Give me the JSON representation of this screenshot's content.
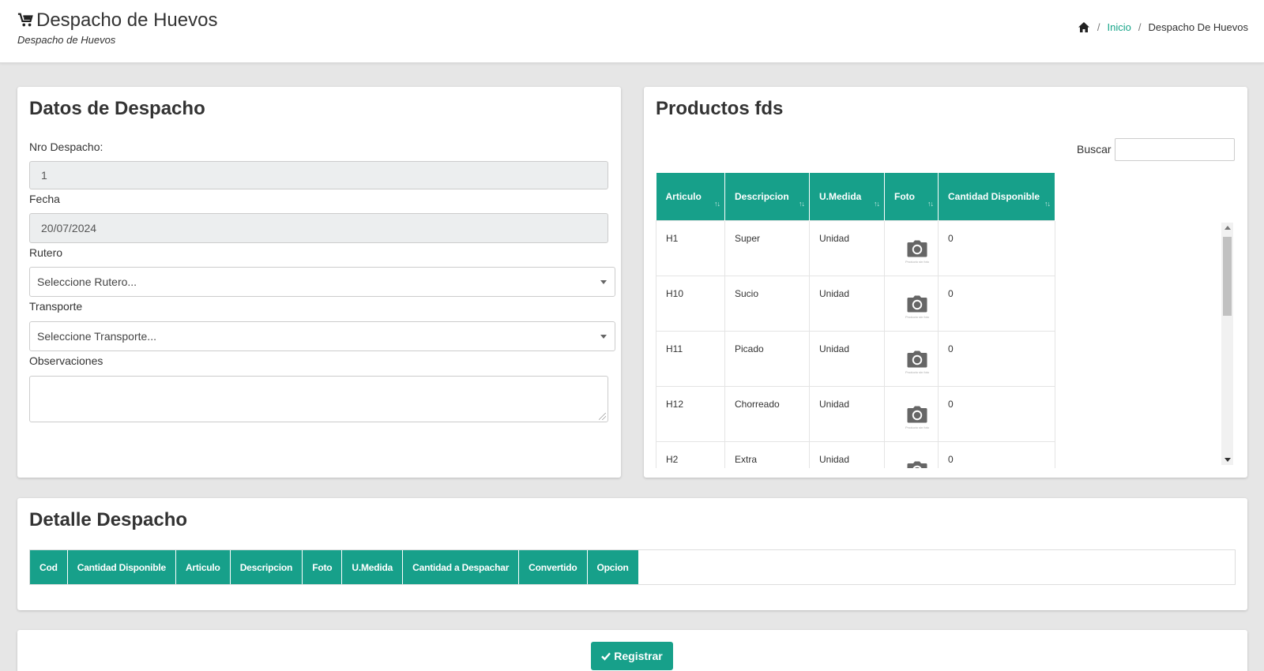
{
  "header": {
    "title": "Despacho de Huevos",
    "subtitle": "Despacho de Huevos",
    "breadcrumb": {
      "home": "Inicio",
      "sep": "/",
      "current": "Despacho De Huevos"
    }
  },
  "datos": {
    "title": "Datos de Despacho",
    "nro_label": "Nro Despacho:",
    "nro_value": "1",
    "fecha_label": "Fecha",
    "fecha_value": "20/07/2024",
    "rutero_label": "Rutero",
    "rutero_value": "Seleccione Rutero...",
    "transporte_label": "Transporte",
    "transporte_value": "Seleccione Transporte...",
    "obs_label": "Observaciones",
    "obs_value": ""
  },
  "productos": {
    "title": "Productos fds",
    "search_label": "Buscar",
    "columns": [
      "Articulo",
      "Descripcion",
      "U.Medida",
      "Foto",
      "Cantidad Disponible"
    ],
    "sort_icon": "↑↓",
    "photo_caption": "Producto sin foto",
    "rows": [
      {
        "articulo": "H1",
        "descripcion": "Super",
        "umedida": "Unidad",
        "cantidad": "0"
      },
      {
        "articulo": "H10",
        "descripcion": "Sucio",
        "umedida": "Unidad",
        "cantidad": "0"
      },
      {
        "articulo": "H11",
        "descripcion": "Picado",
        "umedida": "Unidad",
        "cantidad": "0"
      },
      {
        "articulo": "H12",
        "descripcion": "Chorreado",
        "umedida": "Unidad",
        "cantidad": "0"
      },
      {
        "articulo": "H2",
        "descripcion": "Extra",
        "umedida": "Unidad",
        "cantidad": "0"
      }
    ]
  },
  "detalle": {
    "title": "Detalle Despacho",
    "columns": [
      "Cod",
      "Cantidad Disponible",
      "Articulo",
      "Descripcion",
      "Foto",
      "U.Medida",
      "Cantidad a Despachar",
      "Convertido",
      "Opcion"
    ]
  },
  "actions": {
    "register_label": "Registrar"
  },
  "colors": {
    "accent": "#17a08a",
    "link": "#17a589",
    "background": "#e6e6e6"
  }
}
